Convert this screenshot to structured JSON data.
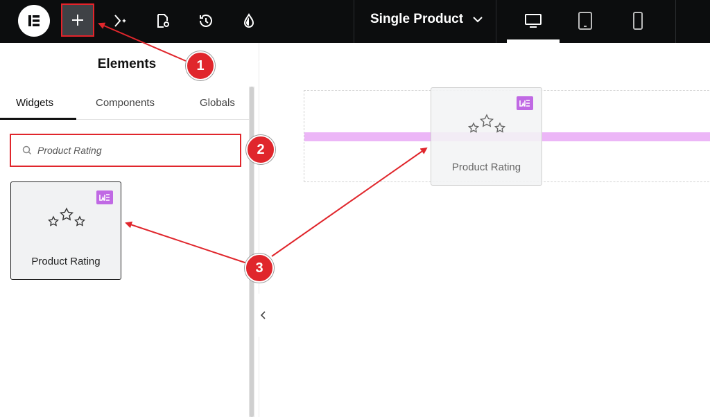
{
  "topbar": {
    "page_selector": "Single Product",
    "icons": [
      "elementor-logo-icon",
      "plus-icon",
      "ai-sparkle-icon",
      "page-settings-icon",
      "history-icon",
      "theme-style-icon"
    ],
    "devices": [
      "desktop-icon",
      "tablet-icon",
      "mobile-icon"
    ]
  },
  "panel": {
    "title": "Elements",
    "tabs": [
      "Widgets",
      "Components",
      "Globals"
    ],
    "search_value": "Product Rating",
    "widget_label": "Product Rating"
  },
  "canvas": {
    "drag_label": "Product Rating"
  },
  "callouts": [
    "1",
    "2",
    "3"
  ],
  "colors": {
    "accent_red": "#e0262c",
    "pro_purple": "#c069e4",
    "drop_indicator": "#ecb6f7"
  }
}
